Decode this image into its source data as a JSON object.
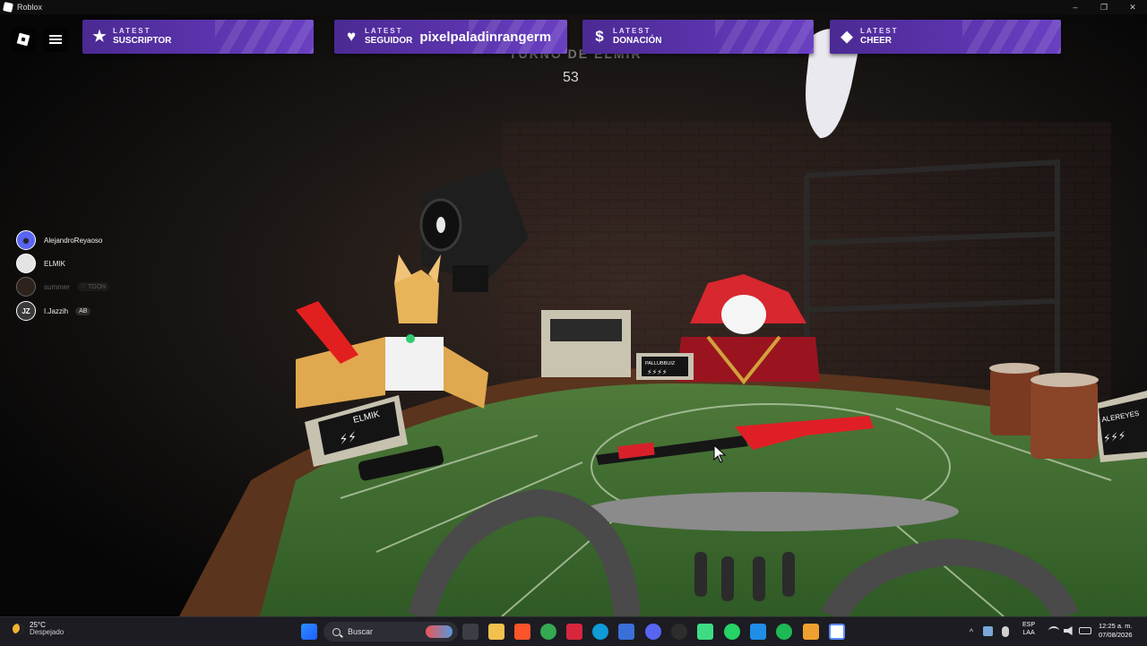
{
  "window": {
    "title": "Roblox",
    "controls": [
      "–",
      "❐",
      "✕"
    ]
  },
  "banners": [
    {
      "icon": "star-icon",
      "latest": "LATEST",
      "label": "SUSCRIPTOR",
      "value": ""
    },
    {
      "icon": "heart-icon",
      "latest": "LATEST",
      "label": "SEGUIDOR",
      "value": "pixelpaladinrangerm"
    },
    {
      "icon": "dollar-icon",
      "latest": "LATEST",
      "label": "DONACIÓN",
      "value": ""
    },
    {
      "icon": "diamond-icon",
      "latest": "LATEST",
      "label": "CHEER",
      "value": ""
    }
  ],
  "timer": {
    "title": "TURNO DE ELMIR",
    "value": "53"
  },
  "players": [
    {
      "name": "AlejandroReyaoso",
      "tag": "",
      "avatar_icon": "discord-icon"
    },
    {
      "name": "ELMIK",
      "tag": "",
      "avatar_icon": "avatar"
    },
    {
      "name": "summer",
      "tag": "♡ TOON",
      "avatar_icon": "avatar"
    },
    {
      "name": "I.Jazzih",
      "tag": "AB",
      "avatar_icon": "avatar",
      "avatar_text": "JZ"
    }
  ],
  "scene": {
    "plates": [
      {
        "name": "ELMIK",
        "charges": "⚡⚡"
      },
      {
        "name": "PALLUBBUIZ",
        "charges": "⚡⚡⚡⚡"
      },
      {
        "name": "ALEREYES",
        "charges": "⚡⚡⚡"
      }
    ]
  },
  "taskbar": {
    "weather_temp": "25°C",
    "weather_cond": "Despejado",
    "search_placeholder": "Buscar",
    "lang_1": "ESP",
    "lang_2": "LAA",
    "time": "12:25 a. m.",
    "date": "07/08/2026",
    "tray_chevron": "^"
  }
}
